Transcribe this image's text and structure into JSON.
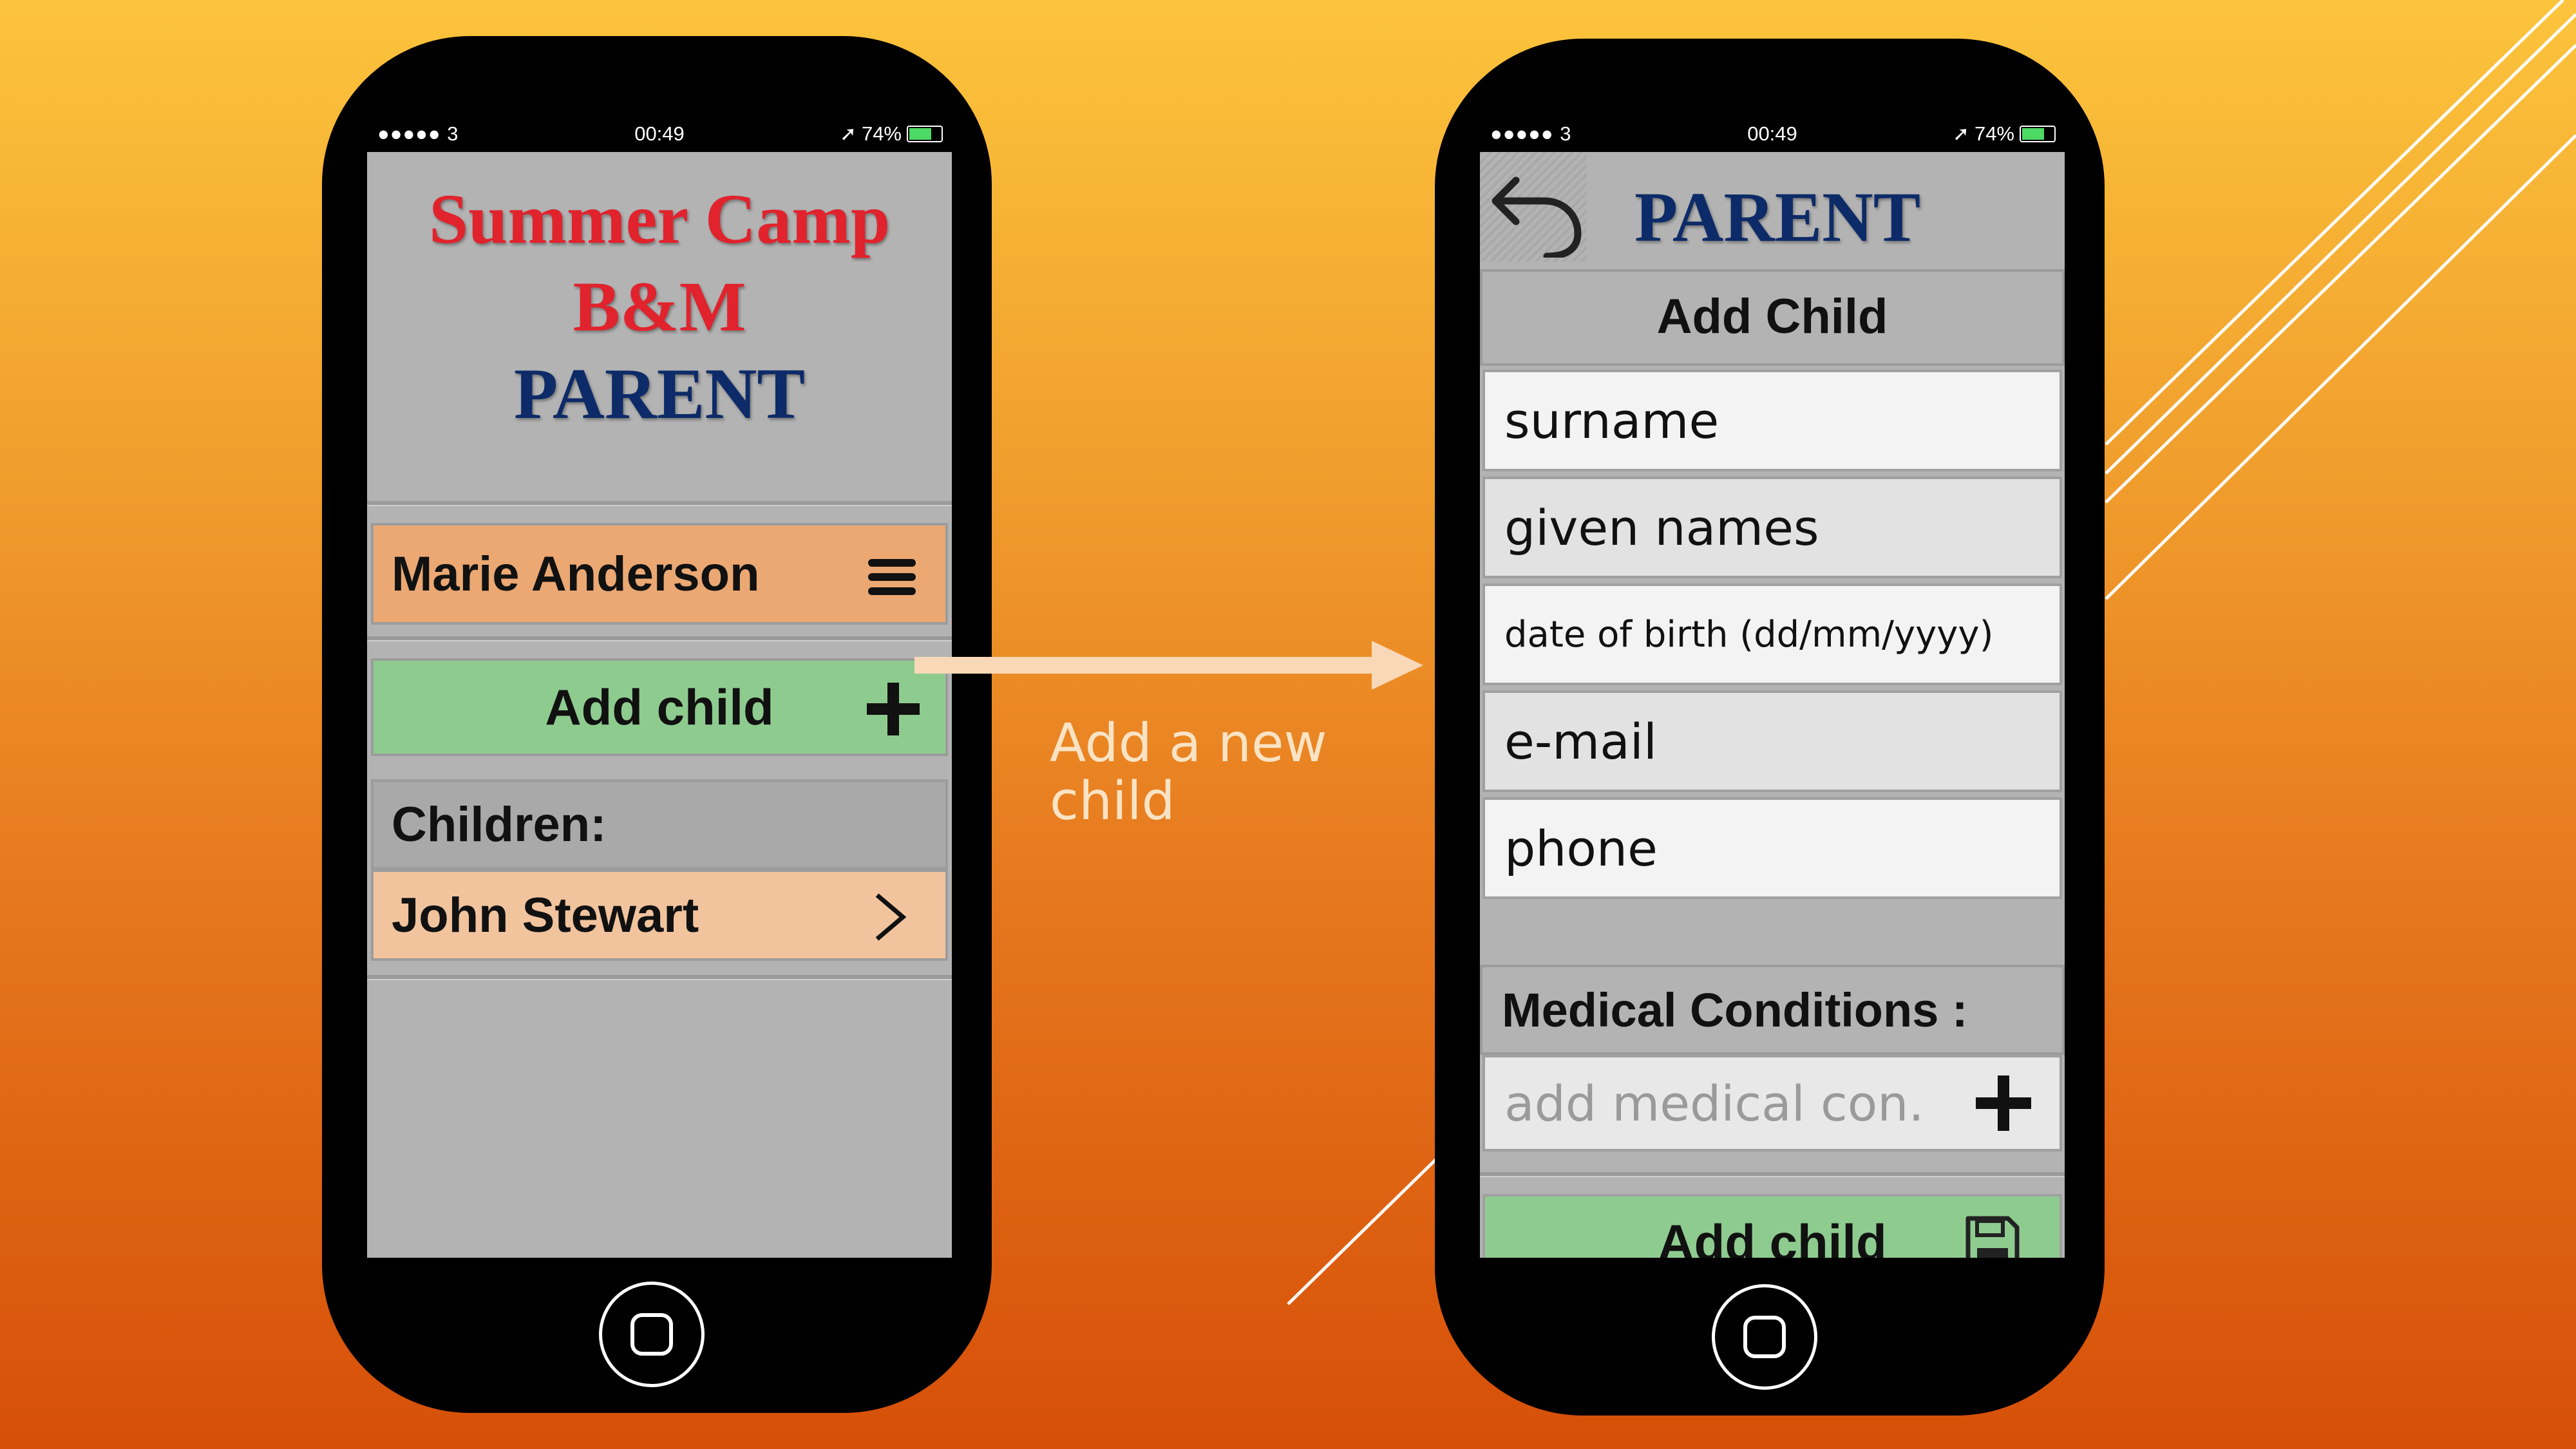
{
  "colors": {
    "title_red": "#e0232d",
    "title_blue": "#0d2b68",
    "user_row": "#eba873",
    "add_row": "#8ecb8f",
    "child_row": "#f1c49e",
    "screen_bg": "#b3b3b3"
  },
  "status_bar": {
    "signal": "●●●●● 3",
    "time": "00:49",
    "battery": "74%",
    "battery_level": 0.74
  },
  "left_screen": {
    "title_line1": "Summer Camp",
    "title_line2": "B&M",
    "title_line3": "PARENT",
    "user_name": "Marie Anderson",
    "menu_icon": "hamburger-menu-icon",
    "add_child_label": "Add child",
    "add_icon": "plus-icon",
    "children_label": "Children:",
    "children": [
      {
        "name": "John Stewart",
        "icon": "chevron-right-icon"
      }
    ]
  },
  "annotation": {
    "caption_line1": "Add a new",
    "caption_line2": "child"
  },
  "right_screen": {
    "back_icon": "undo-back-icon",
    "title": "PARENT",
    "section_title": "Add Child",
    "fields": [
      {
        "placeholder": "surname"
      },
      {
        "placeholder": "given names"
      },
      {
        "placeholder": "date of birth (dd/mm/yyyy)"
      },
      {
        "placeholder": "e-mail"
      },
      {
        "placeholder": "phone"
      }
    ],
    "medical_label": "Medical Conditions :",
    "medical_placeholder": "add medical con.",
    "add_child_label": "Add child",
    "save_icon": "floppy-save-icon"
  }
}
